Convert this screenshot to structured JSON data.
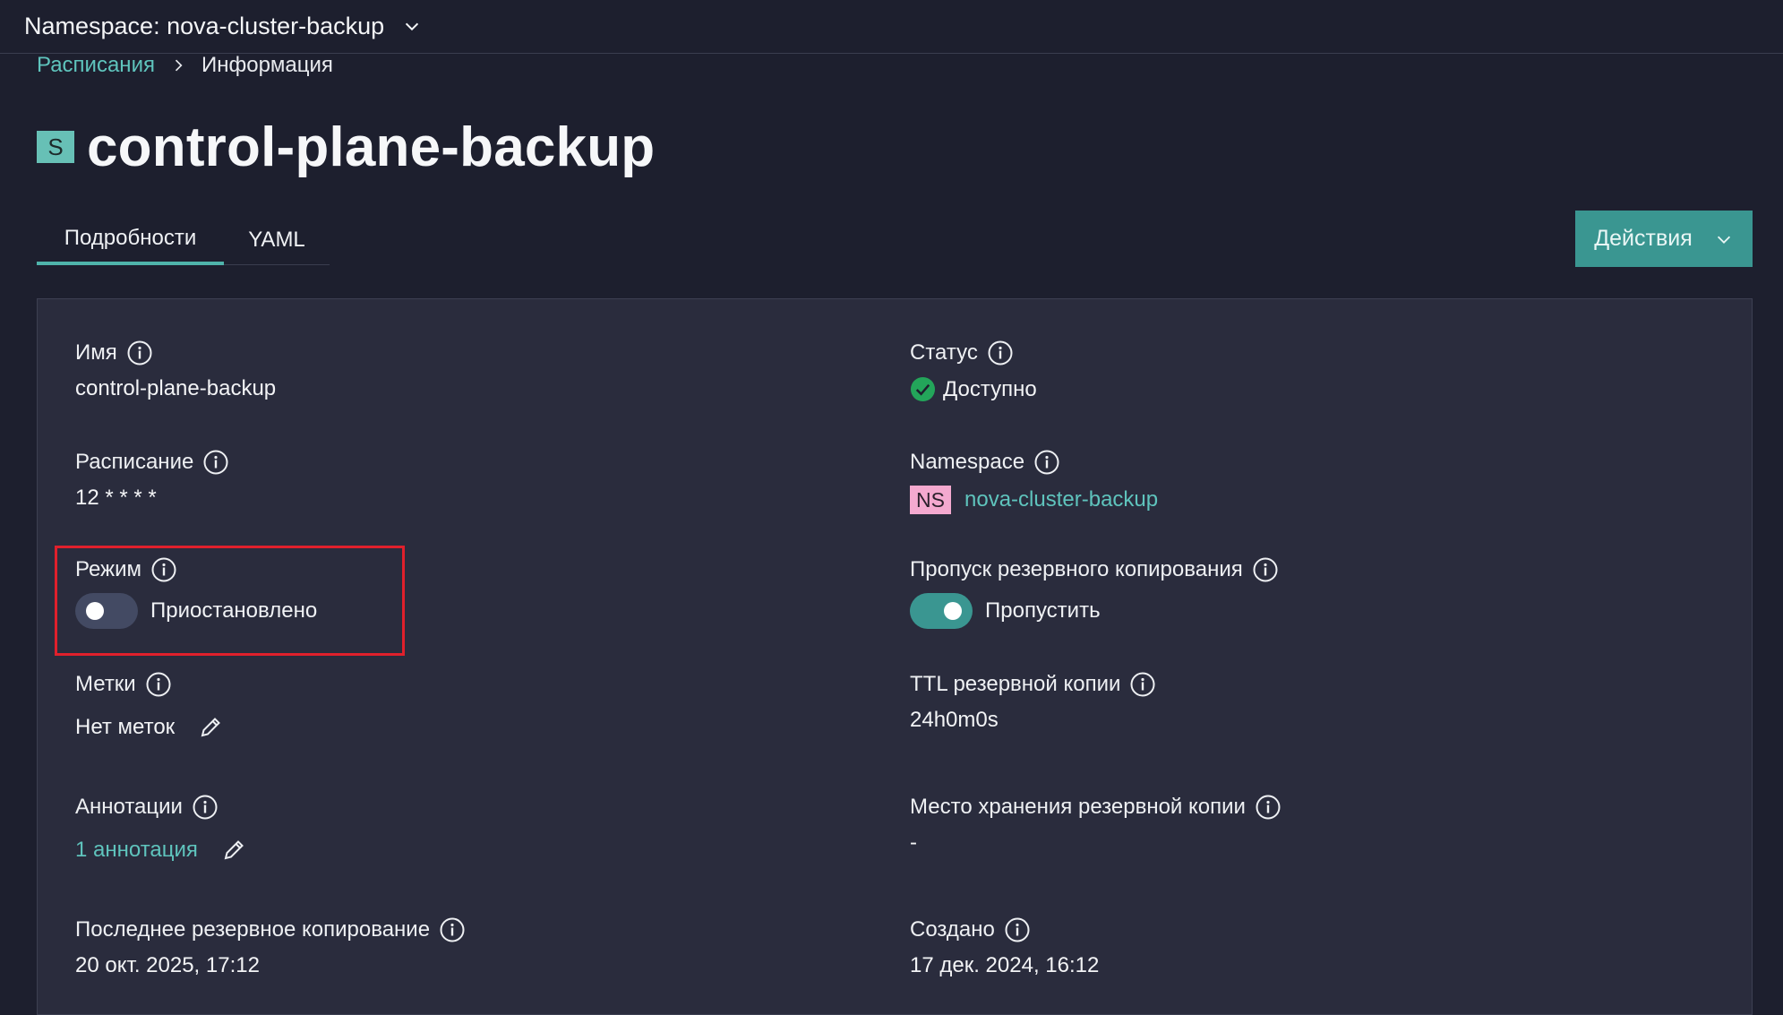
{
  "topbar": {
    "namespace_label": "Namespace: nova-cluster-backup"
  },
  "breadcrumb": {
    "parent": "Расписания",
    "current": "Информация"
  },
  "resource": {
    "kind_badge": "S",
    "title": "control-plane-backup"
  },
  "tabs": [
    {
      "label": "Подробности",
      "active": true
    },
    {
      "label": "YAML",
      "active": false
    }
  ],
  "actions": {
    "label": "Действия"
  },
  "details": {
    "name": {
      "label": "Имя",
      "value": "control-plane-backup"
    },
    "status": {
      "label": "Статус",
      "value": "Доступно",
      "color": "#3cb371"
    },
    "schedule": {
      "label": "Расписание",
      "value": "12 * * * *"
    },
    "namespace": {
      "label": "Namespace",
      "badge": "NS",
      "value": "nova-cluster-backup"
    },
    "mode": {
      "label": "Режим",
      "toggle_text": "Приостановлено",
      "toggle_on": false
    },
    "skip_backup": {
      "label": "Пропуск резервного копирования",
      "toggle_text": "Пропустить",
      "toggle_on": true
    },
    "labels": {
      "label": "Метки",
      "value": "Нет меток"
    },
    "ttl": {
      "label": "TTL резервной копии",
      "value": "24h0m0s"
    },
    "annotations": {
      "label": "Аннотации",
      "value": "1 аннотация"
    },
    "storage_location": {
      "label": "Место хранения резервной копии",
      "value": "-"
    },
    "last_backup": {
      "label": "Последнее резервное копирование",
      "value": "20 окт. 2025, 17:12"
    },
    "created": {
      "label": "Создано",
      "value": "17 дек. 2024, 16:12"
    }
  },
  "colors": {
    "accent": "#3a9691",
    "link": "#5fc4bd",
    "highlight": "#e0202c",
    "ns_badge": "#f4a9cf"
  }
}
